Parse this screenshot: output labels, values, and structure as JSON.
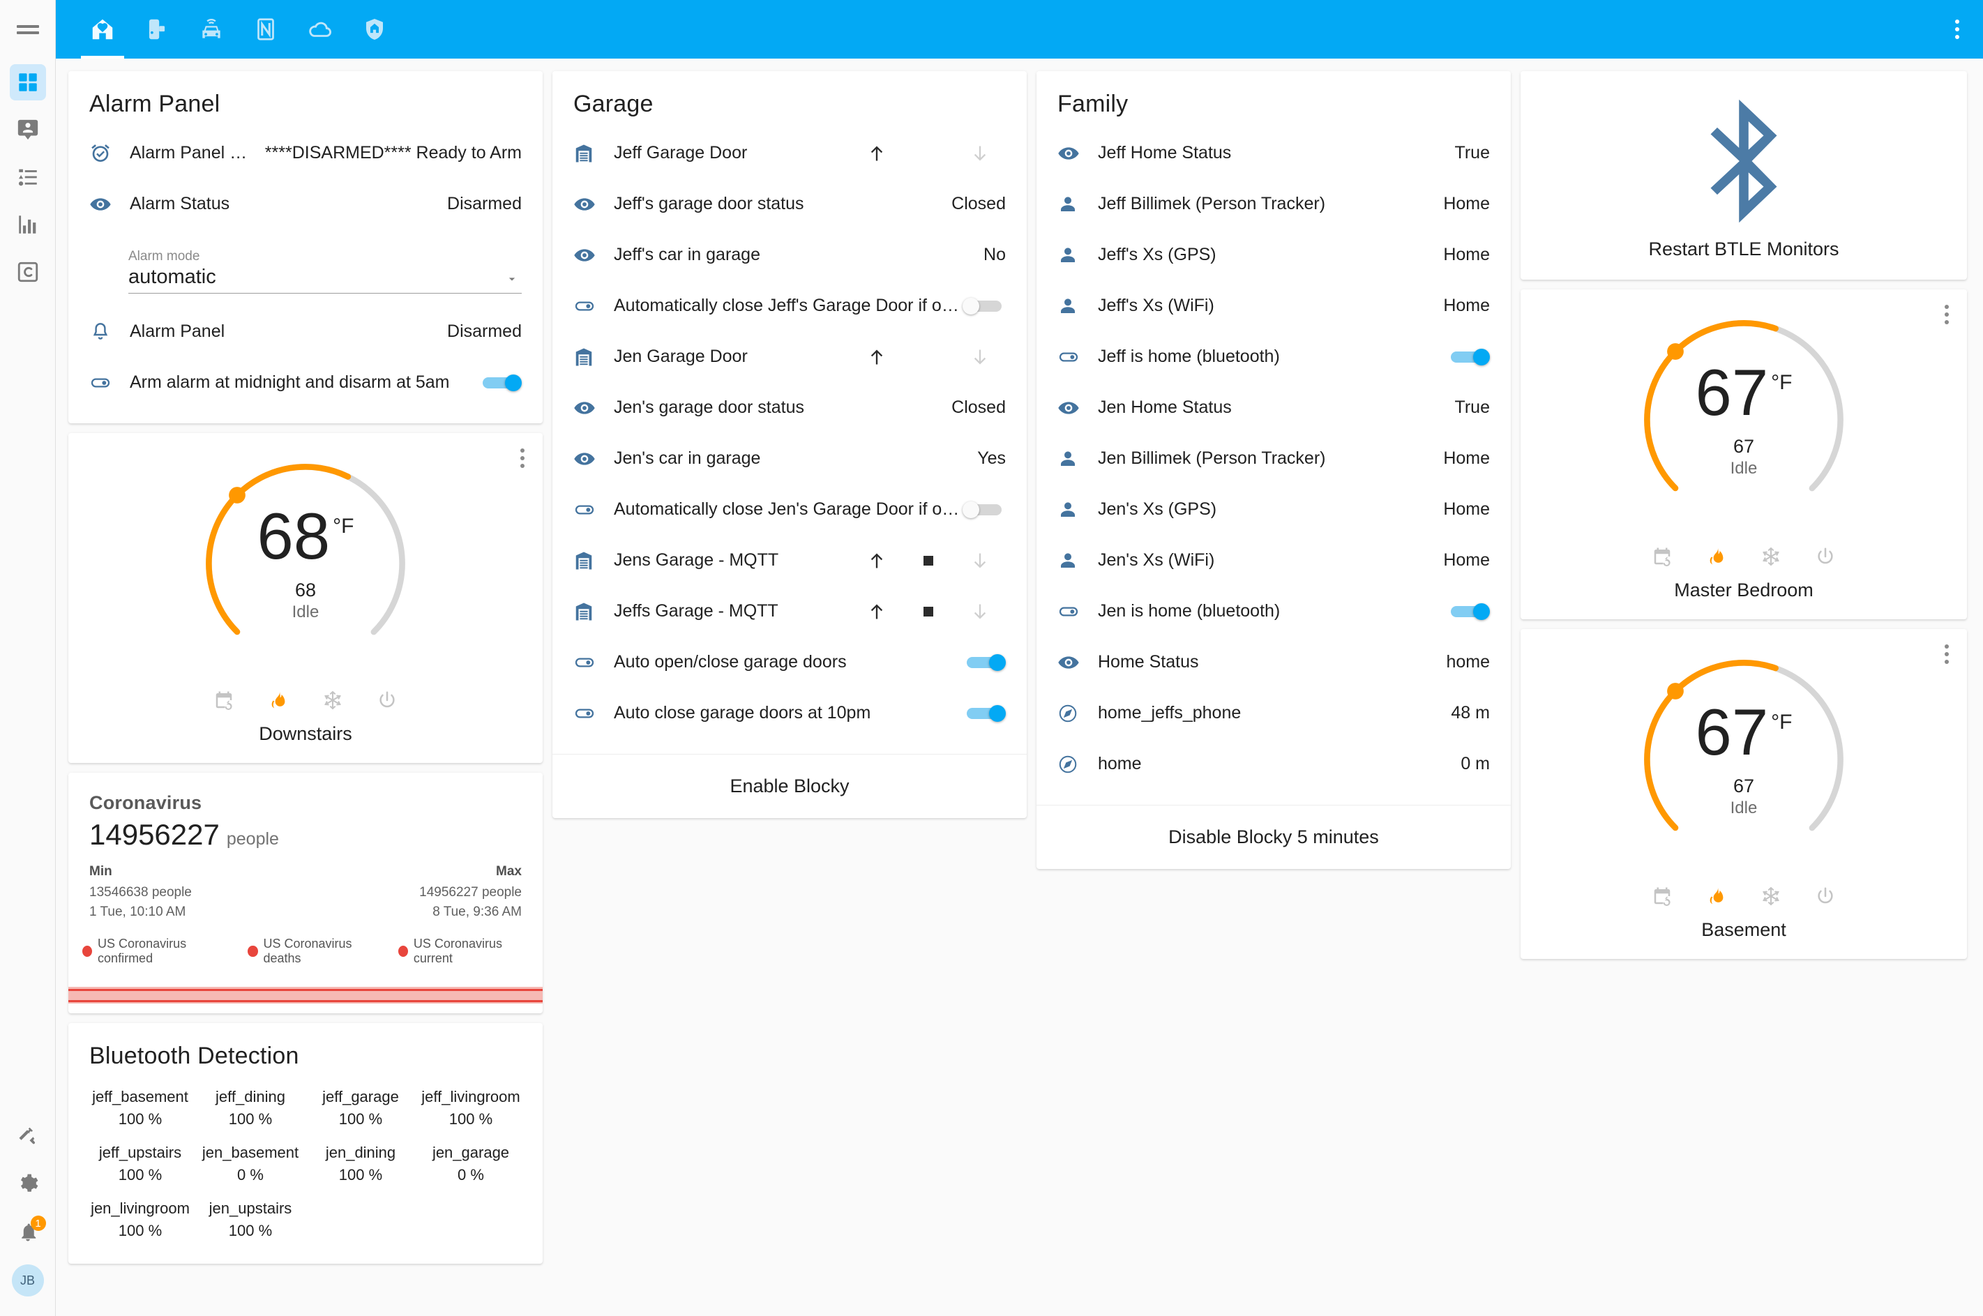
{
  "colors": {
    "accent": "#03a9f4",
    "entity_icon": "#44739e",
    "gauge": "#ff9800",
    "badge": "#ff9800",
    "legend_red": "#e8453c"
  },
  "sidebar": {
    "menu_icon": "hamburger-icon",
    "items": [
      {
        "name": "lovelace-dashboard",
        "icon": "grid-dashboard-icon",
        "active": true
      },
      {
        "name": "map",
        "icon": "person-pin-icon",
        "active": false
      },
      {
        "name": "logbook",
        "icon": "list-icon",
        "active": false
      },
      {
        "name": "history",
        "icon": "chart-bar-icon",
        "active": false
      },
      {
        "name": "c-panel",
        "icon": "letter-c-icon",
        "active": false
      }
    ],
    "bottom": [
      {
        "name": "developer-tools",
        "icon": "hammer-icon"
      },
      {
        "name": "configuration",
        "icon": "gear-icon"
      },
      {
        "name": "notifications",
        "icon": "bell-icon",
        "badge": "1"
      }
    ],
    "user_initials": "JB"
  },
  "topbar": {
    "tabs": [
      {
        "name": "tab-home",
        "icon": "home-heart-icon",
        "active": true
      },
      {
        "name": "tab-locks",
        "icon": "door-lock-icon",
        "active": false
      },
      {
        "name": "tab-car",
        "icon": "car-connected-icon",
        "active": false
      },
      {
        "name": "tab-nfc",
        "icon": "nfc-icon",
        "active": false
      },
      {
        "name": "tab-weather",
        "icon": "cloud-icon",
        "active": false
      },
      {
        "name": "tab-security",
        "icon": "shield-home-icon",
        "active": false
      }
    ],
    "overflow_icon": "dots-vertical-icon"
  },
  "alarm_panel": {
    "title": "Alarm Panel",
    "rows": [
      {
        "icon": "alarm-check-icon",
        "name": "Alarm Panel Display",
        "value": "****DISARMED**** Ready to Arm"
      },
      {
        "icon": "eye-icon",
        "name": "Alarm Status",
        "value": "Disarmed"
      }
    ],
    "select": {
      "label": "Alarm mode",
      "value": "automatic",
      "arrow": "chevron-down-icon"
    },
    "rows2": [
      {
        "icon": "bell-outline-icon",
        "name": "Alarm Panel",
        "value": "Disarmed"
      }
    ],
    "toggle_row": {
      "icon": "toggle-switch-icon",
      "name": "Arm alarm at midnight and disarm at 5am",
      "toggle": "on"
    }
  },
  "downstairs_thermostat": {
    "target": "68",
    "unit": "°F",
    "current": "68",
    "mode": "Idle",
    "name": "Downstairs",
    "overflow_icon": "dots-vertical-icon",
    "controls": [
      {
        "icon": "calendar-sync-icon",
        "active": false
      },
      {
        "icon": "fire-icon",
        "active": true
      },
      {
        "icon": "snowflake-icon",
        "active": false
      },
      {
        "icon": "power-icon",
        "active": false
      }
    ]
  },
  "coronavirus": {
    "title": "Coronavirus",
    "value": "14956227",
    "unit": "people",
    "min_label": "Min",
    "min_value": "13546638 people",
    "min_time": "1 Tue, 10:10 AM",
    "max_label": "Max",
    "max_value": "14956227 people",
    "max_time": "8 Tue, 9:36 AM",
    "legend": [
      "US Coronavirus confirmed",
      "US Coronavirus deaths",
      "US Coronavirus current"
    ]
  },
  "bluetooth_detection": {
    "title": "Bluetooth Detection",
    "cells": [
      {
        "name": "jeff_basement",
        "value": "100 %"
      },
      {
        "name": "jeff_dining",
        "value": "100 %"
      },
      {
        "name": "jeff_garage",
        "value": "100 %"
      },
      {
        "name": "jeff_livingroom",
        "value": "100 %"
      },
      {
        "name": "jeff_upstairs",
        "value": "100 %"
      },
      {
        "name": "jen_basement",
        "value": "0 %"
      },
      {
        "name": "jen_dining",
        "value": "100 %"
      },
      {
        "name": "jen_garage",
        "value": "0 %"
      },
      {
        "name": "jen_livingroom",
        "value": "100 %"
      },
      {
        "name": "jen_upstairs",
        "value": "100 %"
      }
    ]
  },
  "garage": {
    "title": "Garage",
    "rows": [
      {
        "icon": "garage-icon",
        "name": "Jeff Garage Door",
        "type": "cover",
        "up": "enabled",
        "stop": "none",
        "down": "disabled"
      },
      {
        "icon": "eye-icon",
        "name": "Jeff's garage door status",
        "type": "value",
        "value": "Closed"
      },
      {
        "icon": "eye-icon",
        "name": "Jeff's car in garage",
        "type": "value",
        "value": "No"
      },
      {
        "icon": "toggle-switch-icon",
        "name": "Automatically close Jeff's Garage Door if open for...",
        "type": "toggle",
        "toggle": "off"
      },
      {
        "icon": "garage-icon",
        "name": "Jen Garage Door",
        "type": "cover",
        "up": "enabled",
        "stop": "none",
        "down": "disabled"
      },
      {
        "icon": "eye-icon",
        "name": "Jen's garage door status",
        "type": "value",
        "value": "Closed"
      },
      {
        "icon": "eye-icon",
        "name": "Jen's car in garage",
        "type": "value",
        "value": "Yes"
      },
      {
        "icon": "toggle-switch-icon",
        "name": "Automatically close Jen's Garage Door if open for ...",
        "type": "toggle",
        "toggle": "off"
      },
      {
        "icon": "garage-icon",
        "name": "Jens Garage - MQTT",
        "type": "cover",
        "up": "enabled",
        "stop": "enabled",
        "down": "disabled"
      },
      {
        "icon": "garage-icon",
        "name": "Jeffs Garage - MQTT",
        "type": "cover",
        "up": "enabled",
        "stop": "enabled",
        "down": "disabled"
      },
      {
        "icon": "toggle-switch-icon",
        "name": "Auto open/close garage doors",
        "type": "toggle",
        "toggle": "on"
      },
      {
        "icon": "toggle-switch-icon",
        "name": "Auto close garage doors at 10pm",
        "type": "toggle",
        "toggle": "on"
      }
    ],
    "button": "Enable Blocky"
  },
  "family": {
    "title": "Family",
    "rows": [
      {
        "icon": "eye-icon",
        "name": "Jeff Home Status",
        "type": "value",
        "value": "True"
      },
      {
        "icon": "account-icon",
        "name": "Jeff Billimek (Person Tracker)",
        "type": "value",
        "value": "Home"
      },
      {
        "icon": "account-icon",
        "name": "Jeff's Xs (GPS)",
        "type": "value",
        "value": "Home"
      },
      {
        "icon": "account-icon",
        "name": "Jeff's Xs (WiFi)",
        "type": "value",
        "value": "Home"
      },
      {
        "icon": "toggle-switch-icon",
        "name": "Jeff is home (bluetooth)",
        "type": "toggle",
        "toggle": "on"
      },
      {
        "icon": "eye-icon",
        "name": "Jen Home Status",
        "type": "value",
        "value": "True"
      },
      {
        "icon": "account-icon",
        "name": "Jen Billimek (Person Tracker)",
        "type": "value",
        "value": "Home"
      },
      {
        "icon": "account-icon",
        "name": "Jen's Xs (GPS)",
        "type": "value",
        "value": "Home"
      },
      {
        "icon": "account-icon",
        "name": "Jen's Xs (WiFi)",
        "type": "value",
        "value": "Home"
      },
      {
        "icon": "toggle-switch-icon",
        "name": "Jen is home (bluetooth)",
        "type": "toggle",
        "toggle": "on"
      },
      {
        "icon": "eye-icon",
        "name": "Home Status",
        "type": "value",
        "value": "home"
      },
      {
        "icon": "compass-icon",
        "name": "home_jeffs_phone",
        "type": "value",
        "value": "48 m"
      },
      {
        "icon": "compass-icon",
        "name": "home",
        "type": "value",
        "value": "0 m"
      }
    ],
    "button": "Disable Blocky 5 minutes"
  },
  "btle_card": {
    "icon": "bluetooth-icon",
    "label": "Restart BTLE Monitors"
  },
  "master_bedroom_thermostat": {
    "target": "67",
    "unit": "°F",
    "current": "67",
    "mode": "Idle",
    "name": "Master Bedroom",
    "overflow_icon": "dots-vertical-icon",
    "controls": [
      {
        "icon": "calendar-sync-icon",
        "active": false
      },
      {
        "icon": "fire-icon",
        "active": true
      },
      {
        "icon": "snowflake-icon",
        "active": false
      },
      {
        "icon": "power-icon",
        "active": false
      }
    ]
  },
  "basement_thermostat": {
    "target": "67",
    "unit": "°F",
    "current": "67",
    "mode": "Idle",
    "name": "Basement",
    "overflow_icon": "dots-vertical-icon",
    "controls": [
      {
        "icon": "calendar-sync-icon",
        "active": false
      },
      {
        "icon": "fire-icon",
        "active": true
      },
      {
        "icon": "snowflake-icon",
        "active": false
      },
      {
        "icon": "power-icon",
        "active": false
      }
    ]
  }
}
